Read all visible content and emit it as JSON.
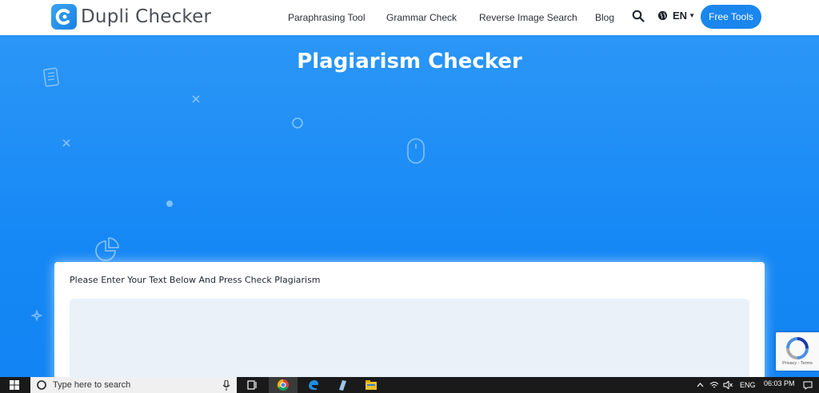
{
  "header": {
    "logo_text": "Dupli Checker",
    "nav": [
      {
        "label": "Paraphrasing Tool"
      },
      {
        "label": "Grammar Check"
      },
      {
        "label": "Reverse Image Search"
      },
      {
        "label": "Blog"
      }
    ],
    "search_icon": "search-icon",
    "lang_label": "EN",
    "cta_label": "Free Tools"
  },
  "hero": {
    "title": "Plagiarism Checker"
  },
  "card": {
    "prompt": "Please Enter Your Text Below And Press Check Plagiarism"
  },
  "recaptcha": {
    "text": "Privacy - Terms"
  },
  "taskbar": {
    "search_placeholder": "Type here to search",
    "lang": "ENG",
    "time": "06:03 PM"
  },
  "colors": {
    "brand_blue": "#1a86ee",
    "hero_blue": "#1688f5",
    "textarea_bg": "#ebf1f9"
  }
}
